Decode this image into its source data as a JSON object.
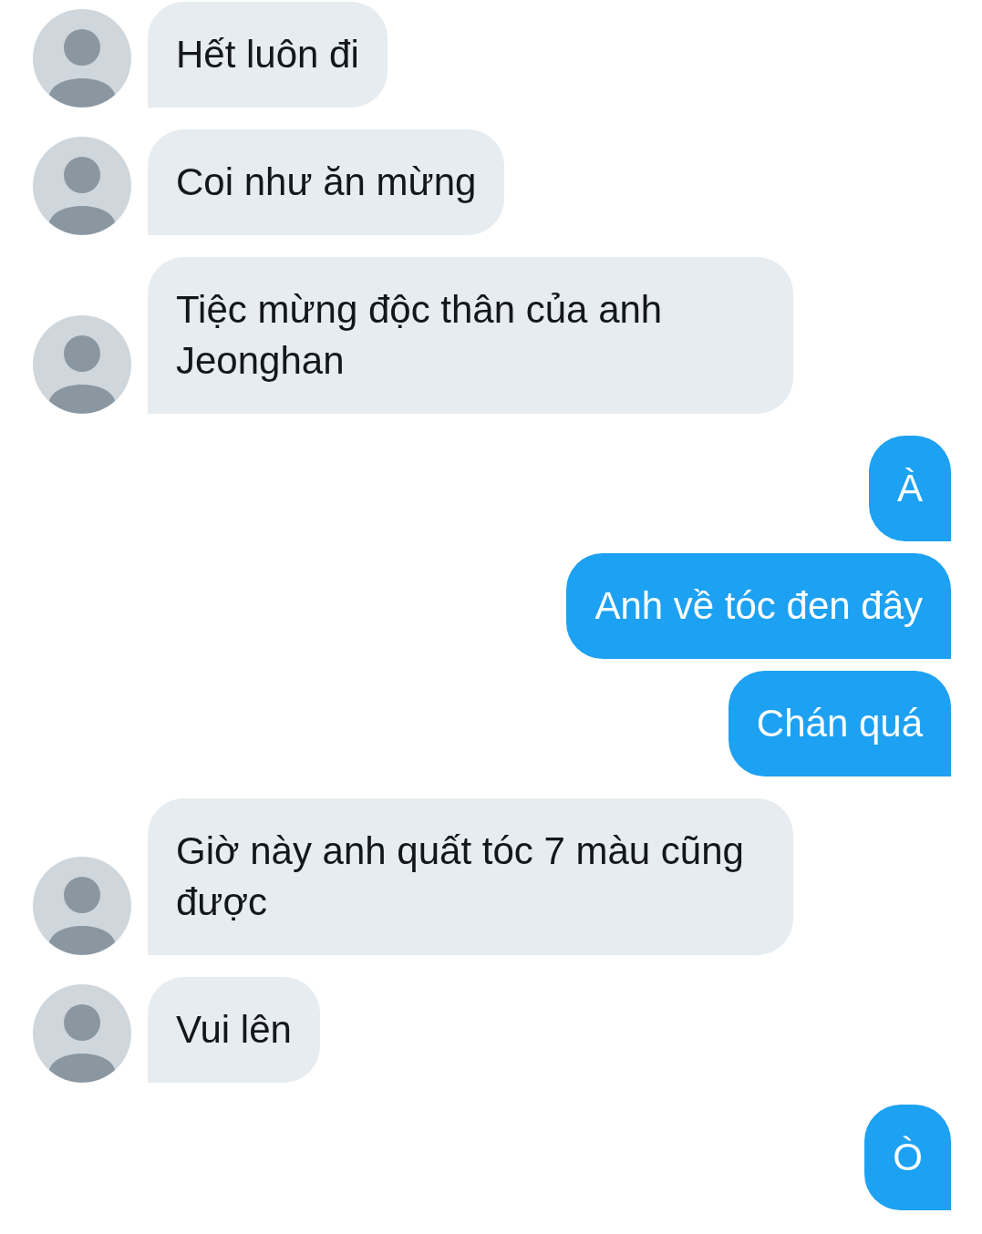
{
  "messages": [
    {
      "kind": "incoming",
      "text": "Hết luôn đi"
    },
    {
      "kind": "incoming",
      "text": "Coi như ăn mừng"
    },
    {
      "kind": "incoming",
      "text": "Tiệc mừng độc thân của anh Jeonghan"
    },
    {
      "kind": "outgoing",
      "text": "À"
    },
    {
      "kind": "outgoing",
      "text": "Anh về tóc đen đây"
    },
    {
      "kind": "outgoing",
      "text": "Chán quá"
    },
    {
      "kind": "incoming",
      "text": "Giờ này anh quất tóc 7 màu cũng được"
    },
    {
      "kind": "incoming",
      "text": "Vui lên"
    },
    {
      "kind": "outgoing",
      "text": "Ò"
    }
  ]
}
